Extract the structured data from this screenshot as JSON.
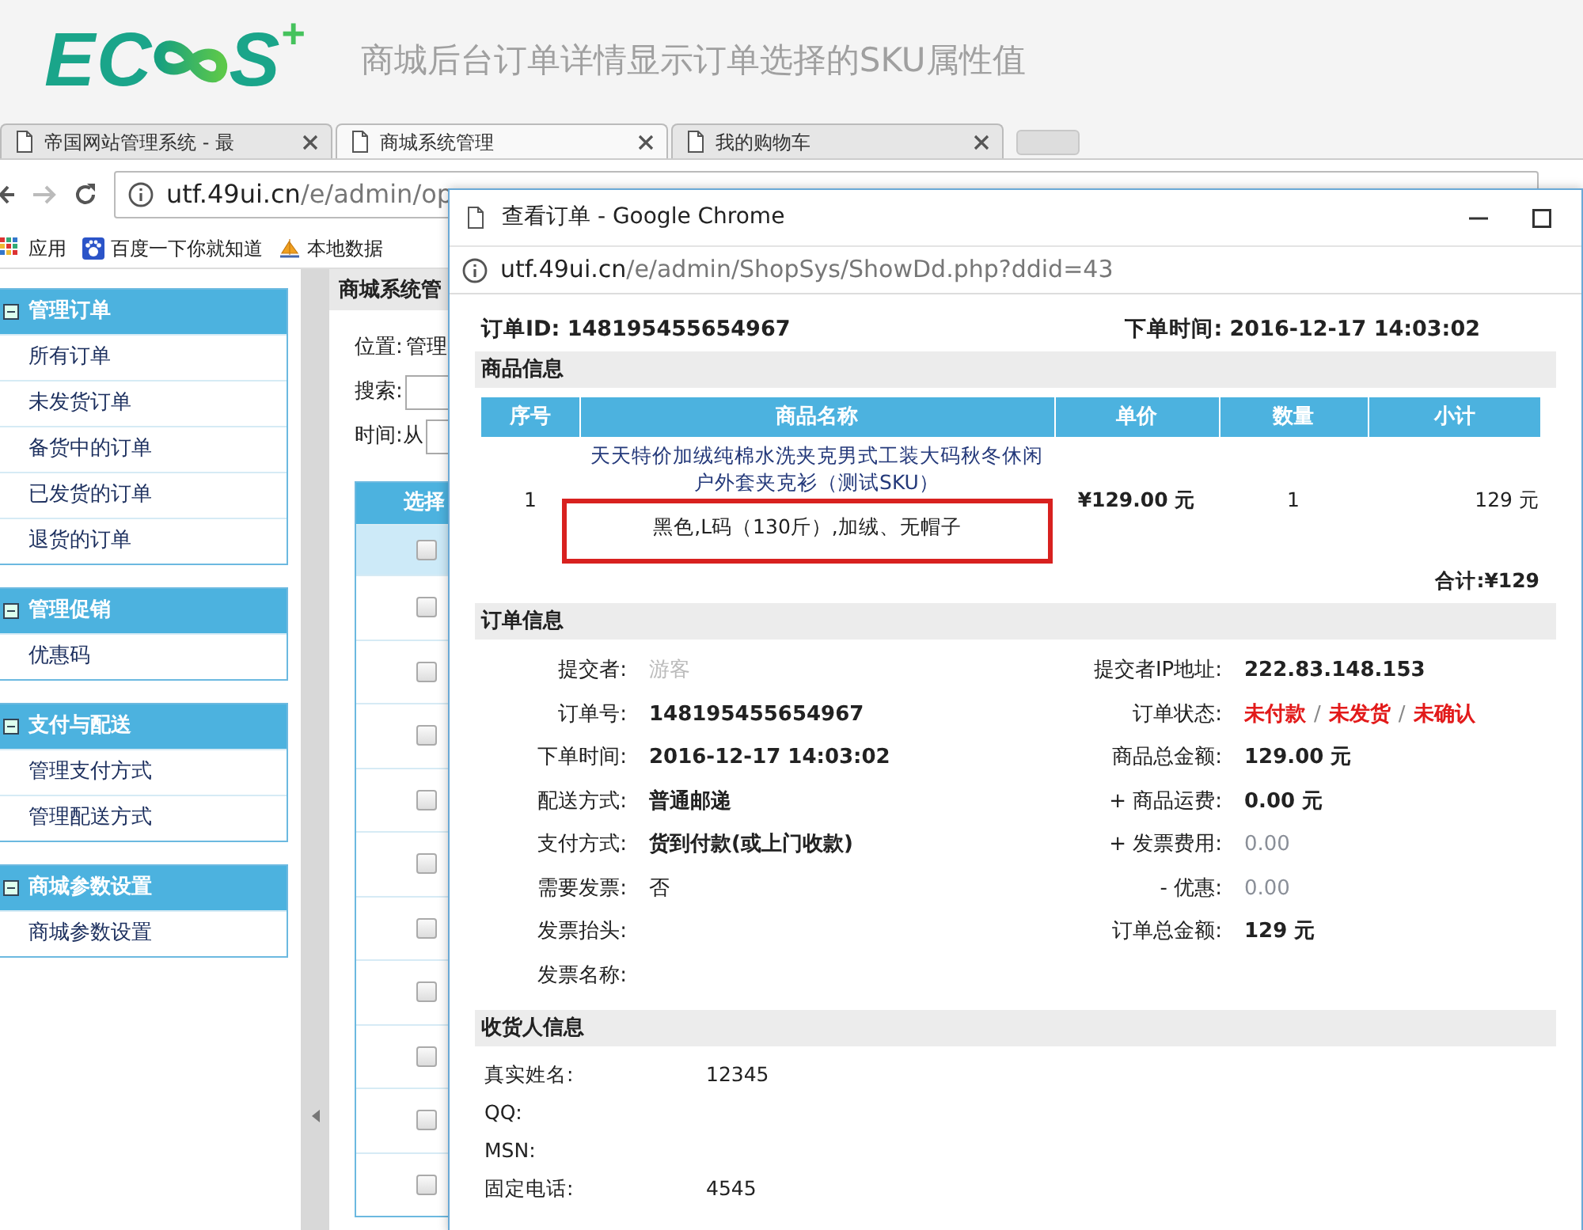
{
  "header": {
    "logo": {
      "left": "EC",
      "right": "S",
      "plus": "+"
    },
    "title": "商城后台订单详情显示订单选择的SKU属性值"
  },
  "browser": {
    "tabs": [
      {
        "label": "帝国网站管理系统 - 最",
        "selected": false
      },
      {
        "label": "商城系统管理",
        "selected": true
      },
      {
        "label": "我的购物车",
        "selected": false
      }
    ],
    "address": {
      "host": "utf.49ui.cn",
      "path": "/e/admin/op"
    },
    "bookmarks": [
      {
        "kind": "apps",
        "label": "应用"
      },
      {
        "kind": "paw",
        "label": "百度一下你就知道"
      },
      {
        "kind": "pma",
        "label": "本地数据"
      }
    ]
  },
  "sidebar": {
    "groups": [
      {
        "title": "管理订单",
        "items": [
          "所有订单",
          "未发货订单",
          "备货中的订单",
          "已发货的订单",
          "退货的订单"
        ]
      },
      {
        "title": "管理促销",
        "items": [
          "优惠码"
        ]
      },
      {
        "title": "支付与配送",
        "items": [
          "管理支付方式",
          "管理配送方式"
        ]
      },
      {
        "title": "商城参数设置",
        "items": [
          "商城参数设置"
        ]
      }
    ]
  },
  "page": {
    "title": "商城系统管",
    "location": {
      "label": "位置:",
      "value": "管理"
    },
    "search_label": "搜索:",
    "time_label": "时间:从",
    "table": {
      "columns": [
        "选择"
      ],
      "rows": [
        {
          "selected": true,
          "checked": false
        },
        {
          "selected": false,
          "checked": false
        },
        {
          "selected": false,
          "checked": false
        },
        {
          "selected": false,
          "checked": false
        },
        {
          "selected": false,
          "checked": false
        },
        {
          "selected": false,
          "checked": false
        },
        {
          "selected": false,
          "checked": false
        },
        {
          "selected": false,
          "checked": false
        },
        {
          "selected": false,
          "checked": false
        },
        {
          "selected": false,
          "checked": false
        },
        {
          "selected": false,
          "checked": false
        }
      ]
    }
  },
  "popup": {
    "title": "查看订单 - Google Chrome",
    "url": {
      "host": "utf.49ui.cn",
      "path": "/e/admin/ShopSys/ShowDd.php?ddid=43"
    },
    "order_id": {
      "label": "订单ID:",
      "value": "148195455654967"
    },
    "order_time": {
      "label": "下单时间:",
      "value": "2016-12-17 14:03:02"
    },
    "goods": {
      "title": "商品信息",
      "columns": [
        "序号",
        "商品名称",
        "单价",
        "数量",
        "小计"
      ],
      "rows": [
        {
          "index": "1",
          "name": "天天特价加绒纯棉水洗夹克男式工装大码秋冬休闲户外套夹克衫（测试SKU）",
          "sku": "黑色,L码（130斤）,加绒、无帽子",
          "sku_highlighted": true,
          "price": "¥129.00 元",
          "quantity": "1",
          "subtotal": "129 元"
        }
      ],
      "total": "合计:¥129"
    },
    "order_info": {
      "title": "订单信息",
      "left": [
        {
          "label": "提交者:",
          "value": "游客",
          "kind": "guest"
        },
        {
          "label": "订单号:",
          "value": "148195455654967",
          "kind": "key"
        },
        {
          "label": "下单时间:",
          "value": "2016-12-17 14:03:02",
          "kind": "key"
        },
        {
          "label": "配送方式:",
          "value": "普通邮递",
          "kind": "key"
        },
        {
          "label": "支付方式:",
          "value": "货到付款(或上门收款)",
          "kind": "key"
        },
        {
          "label": "需要发票:",
          "value": "否",
          "kind": "normal"
        },
        {
          "label": "发票抬头:"
        },
        {
          "label": "发票名称:"
        }
      ],
      "right": [
        {
          "label": "提交者IP地址:",
          "value": "222.83.148.153",
          "kind": "key"
        },
        {
          "label": "订单状态:",
          "statuses": [
            "未付款",
            "未发货",
            "未确认"
          ],
          "separators": [
            "/",
            "/"
          ]
        },
        {
          "label": "商品总金额:",
          "value": "129.00 元",
          "kind": "key"
        },
        {
          "label": "+ 商品运费:",
          "value": "0.00 元",
          "kind": "key"
        },
        {
          "label": "+ 发票费用:",
          "value": "0.00",
          "kind": "fee"
        },
        {
          "label": "- 优惠:",
          "value": "0.00",
          "kind": "fee"
        },
        {
          "label": "订单总金额:",
          "value": "129 元",
          "kind": "key"
        }
      ]
    },
    "receiver": {
      "title": "收货人信息",
      "rows": [
        {
          "label": "真实姓名:",
          "value": "12345"
        },
        {
          "label": "QQ:"
        },
        {
          "label": "MSN:"
        },
        {
          "label": "固定电话:",
          "value": "4545"
        }
      ]
    }
  }
}
